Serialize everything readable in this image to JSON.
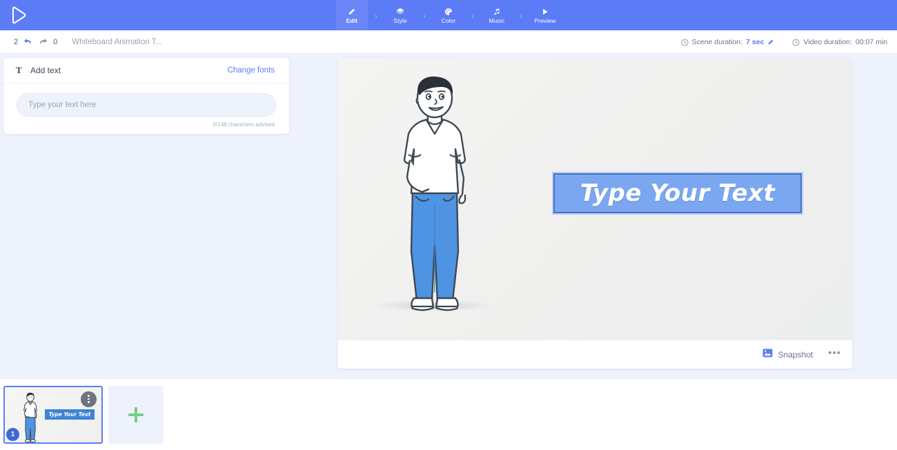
{
  "header": {
    "logo_icon": "play-triangle-logo",
    "brand_color": "#5c7cf7",
    "steps": [
      {
        "label": "Edit",
        "icon": "pencil-icon",
        "active": true
      },
      {
        "label": "Style",
        "icon": "layers-icon",
        "active": false
      },
      {
        "label": "Color",
        "icon": "palette-icon",
        "active": false
      },
      {
        "label": "Music",
        "icon": "music-note-icon",
        "active": false
      },
      {
        "label": "Preview",
        "icon": "play-icon",
        "active": false
      }
    ],
    "separator": "›"
  },
  "toolbar": {
    "undo_count": "2",
    "redo_count": "0",
    "undo_icon": "undo-arrow-icon",
    "redo_icon": "redo-arrow-icon",
    "document_title": "Whiteboard Animation T...",
    "scene_duration_label": "Scene duration:",
    "scene_duration_value": "7 sec",
    "scene_duration_edit_icon": "pencil-edit-icon",
    "video_duration_label": "Video duration:",
    "video_duration_value": "00:07 min",
    "clock_icon": "clock-icon",
    "accent_color": "#5c7cf7"
  },
  "text_panel": {
    "icon": "text-T-icon",
    "title": "Add text",
    "change_fonts_label": "Change fonts",
    "input_placeholder": "Type your text here",
    "input_value": "",
    "char_hint": "0/148 characters advised"
  },
  "stage": {
    "canvas_background": "#f1f1f0",
    "character_alt": "standing-man-illustration",
    "text_object": {
      "text": "Type Your Text",
      "fill_color": "#7aa7ef",
      "border_color": "#4571c8",
      "text_color": "#ffffff",
      "selected": true
    },
    "snapshot_label": "Snapshot",
    "snapshot_icon": "image-icon",
    "more_menu_icon": "ellipsis-icon",
    "more_menu_label": "•••"
  },
  "timeline": {
    "scenes": [
      {
        "number": "1",
        "selected": true,
        "thumb_text": "Type Your Text",
        "menu_icon": "vertical-ellipsis-icon"
      }
    ],
    "add_scene_icon": "plus-icon",
    "add_scene_color": "#79cb8a"
  }
}
